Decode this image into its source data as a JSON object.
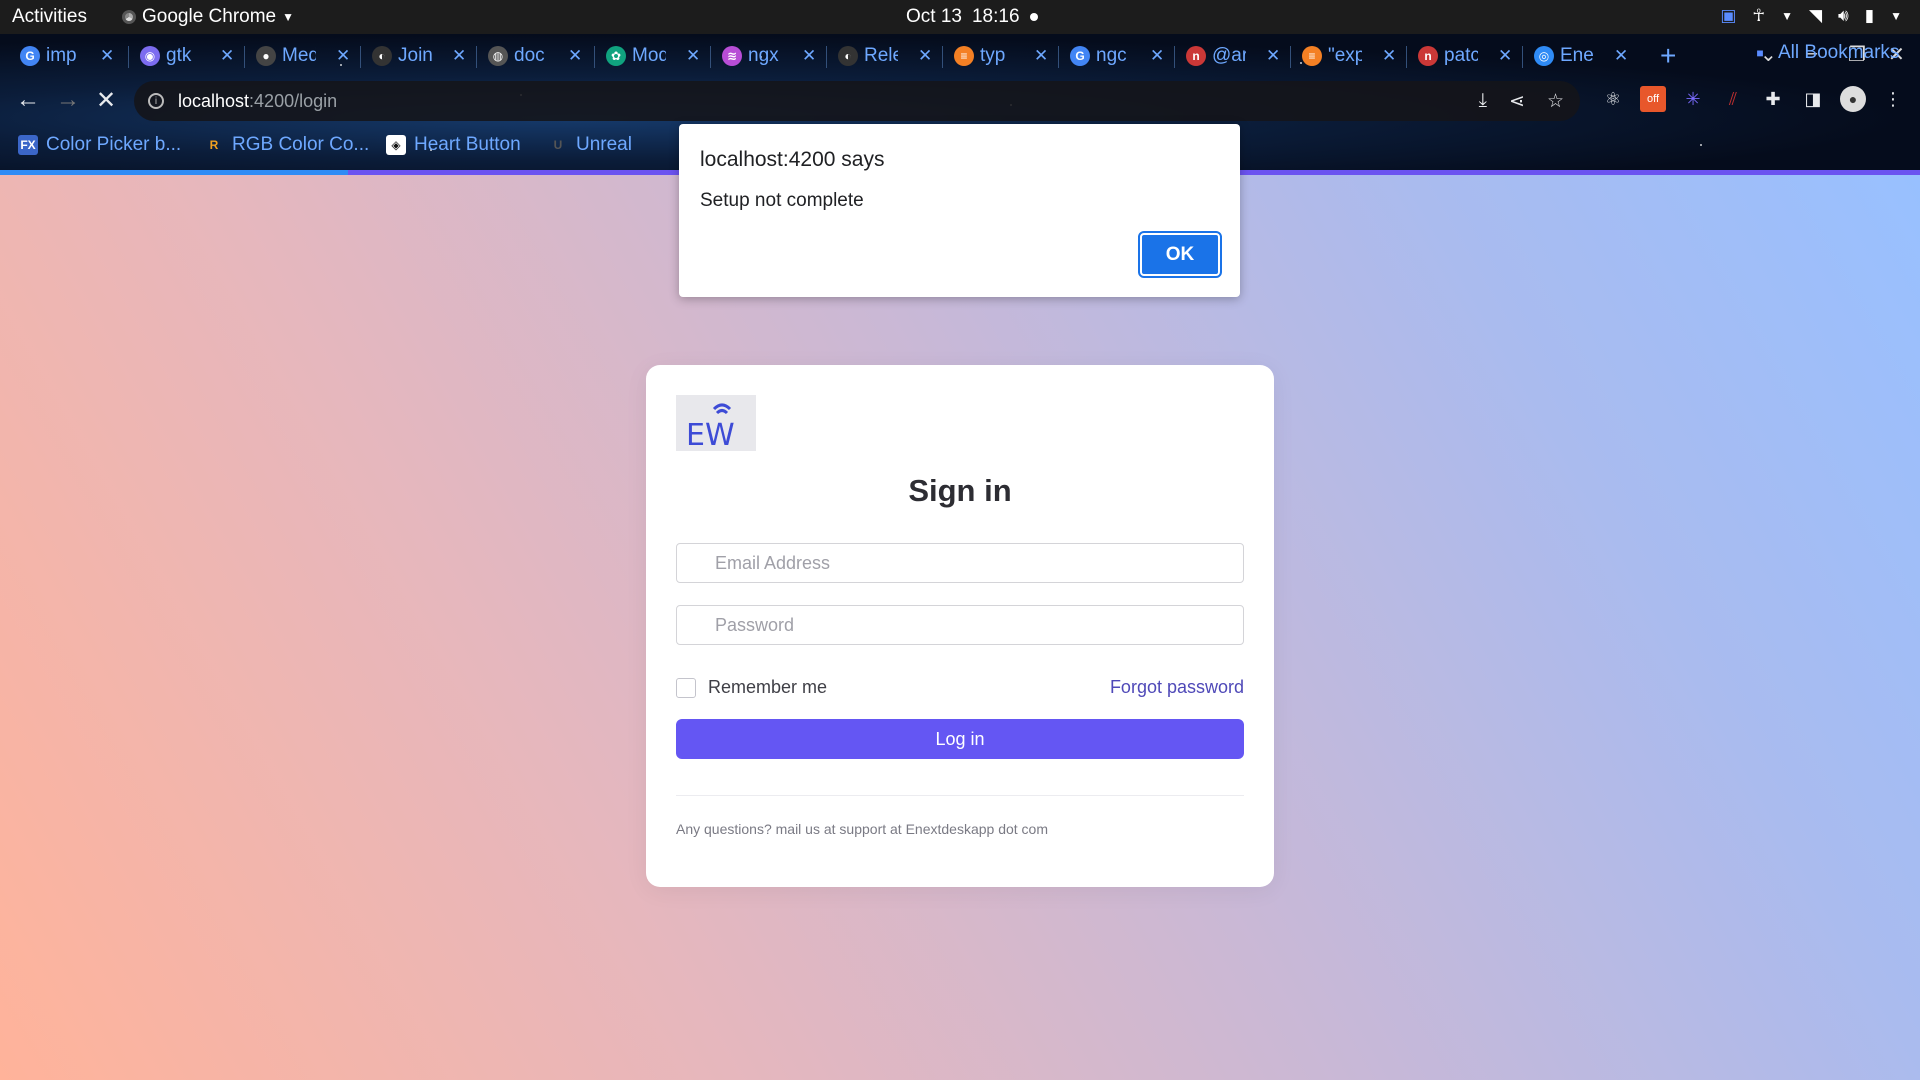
{
  "system": {
    "activities": "Activities",
    "app_name": "Google Chrome",
    "date": "Oct 13",
    "time": "18:16"
  },
  "tabs": [
    {
      "label": "imp",
      "icon": "google-icon",
      "color": "#4285f4"
    },
    {
      "label": "gtk",
      "icon": "gtk-icon",
      "color": "#7c6cf0"
    },
    {
      "label": "Med",
      "icon": "medium-icon",
      "color": "#444"
    },
    {
      "label": "Join",
      "icon": "github-icon",
      "color": "#333"
    },
    {
      "label": "doc",
      "icon": "globe-icon",
      "color": "#555"
    },
    {
      "label": "Mod",
      "icon": "openai-icon",
      "color": "#10a37f"
    },
    {
      "label": "ngx",
      "icon": "ngx-icon",
      "color": "#b84dd6"
    },
    {
      "label": "Rele",
      "icon": "github-icon",
      "color": "#333"
    },
    {
      "label": "typ",
      "icon": "stackoverflow-icon",
      "color": "#f48024"
    },
    {
      "label": "ngc",
      "icon": "google-icon",
      "color": "#4285f4"
    },
    {
      "label": "@ar",
      "icon": "npm-icon",
      "color": "#cb3837"
    },
    {
      "label": "\"exp",
      "icon": "stackoverflow-icon",
      "color": "#f48024"
    },
    {
      "label": "patc",
      "icon": "npm-icon",
      "color": "#cb3837"
    },
    {
      "label": "Ene",
      "icon": "app-icon",
      "color": "#2f8bf5"
    }
  ],
  "address_bar": {
    "host": "localhost",
    "path": ":4200/login"
  },
  "bookmarks": [
    {
      "label": "Color Picker b...",
      "icon": "fx-icon",
      "badge": "FX"
    },
    {
      "label": "RGB Color Co...",
      "icon": "r-icon",
      "badge": "R"
    },
    {
      "label": "Heart Button",
      "icon": "codepen-icon",
      "badge": "◈"
    },
    {
      "label": "Unreal",
      "icon": "unreal-icon",
      "badge": "U"
    }
  ],
  "all_bookmarks": "All Bookmarks",
  "dialog": {
    "title": "localhost:4200 says",
    "message": "Setup not complete",
    "ok_label": "OK"
  },
  "login": {
    "logo_text": "EW",
    "title": "Sign in",
    "email_placeholder": "Email Address",
    "password_placeholder": "Password",
    "remember_label": "Remember me",
    "forgot_label": "Forgot password",
    "login_label": "Log in",
    "footer": "Any questions? mail us at support at Enextdeskapp dot com"
  },
  "colors": {
    "primary_button": "#6456f3",
    "dialog_ok": "#1a73e8",
    "link": "#4f49b8"
  }
}
